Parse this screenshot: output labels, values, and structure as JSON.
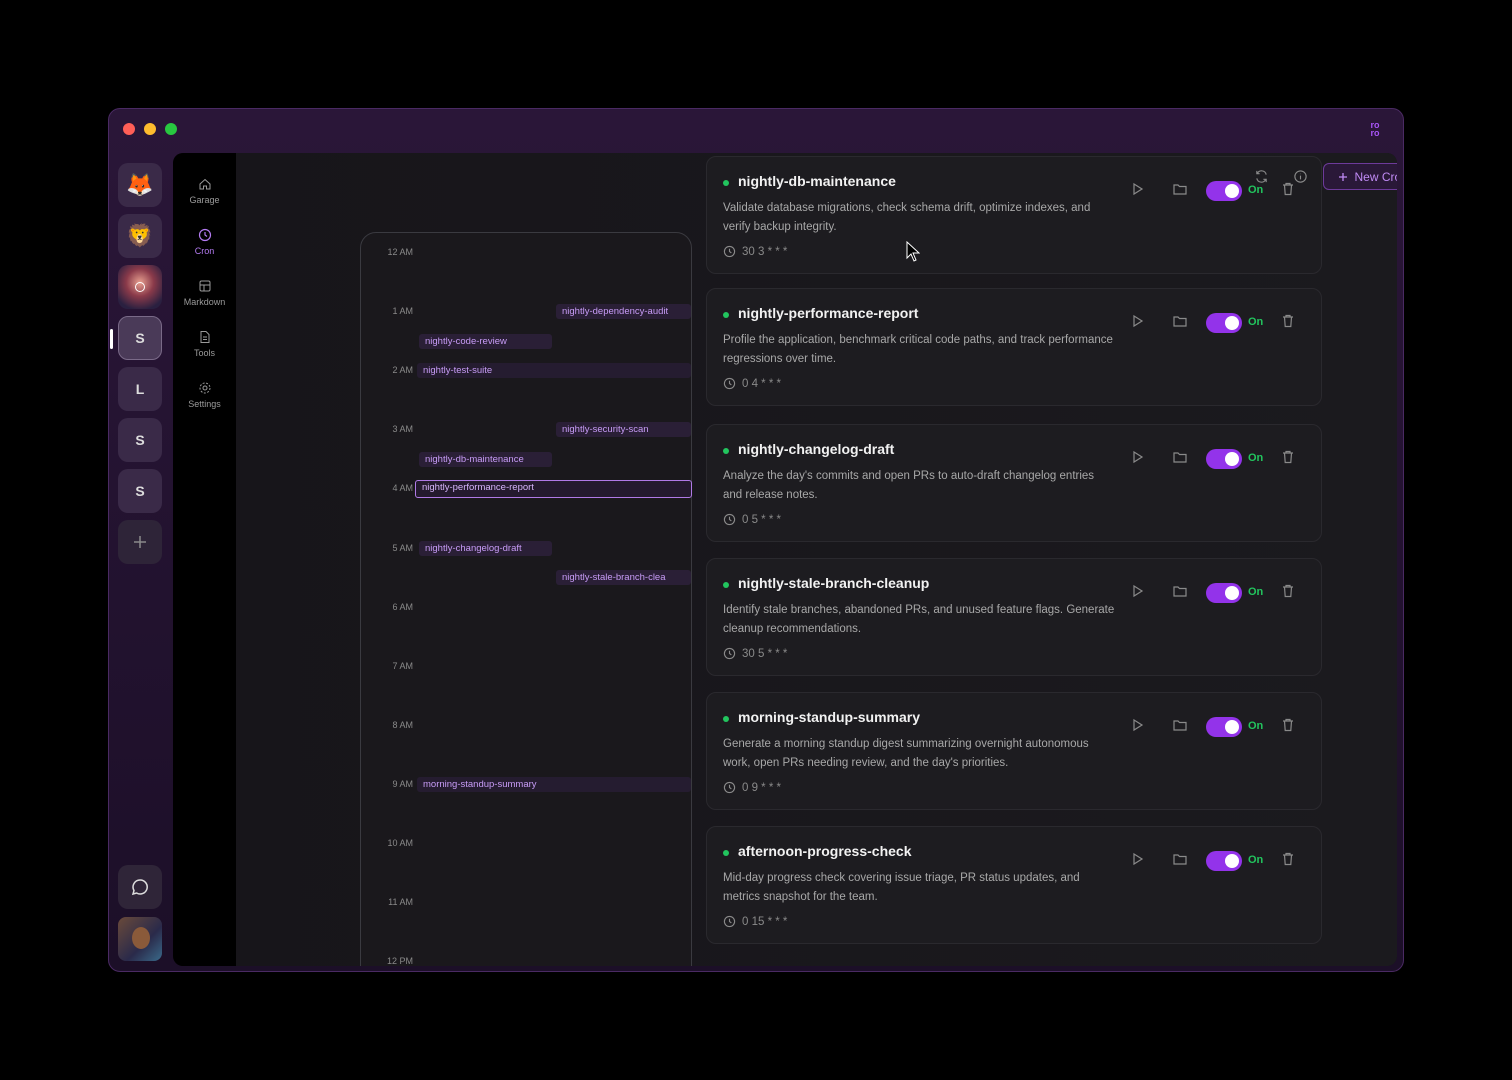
{
  "app": {
    "brand_mark": "ro\nro"
  },
  "workspaces": [
    {
      "label": "",
      "icon": "fox-emoji-icon",
      "emoji": "🦊"
    },
    {
      "label": "",
      "icon": "lion-emoji-icon",
      "emoji": "🦁"
    },
    {
      "label": "",
      "icon": "landscape-avatar-icon",
      "emoji": ""
    },
    {
      "label": "S",
      "active": true
    },
    {
      "label": "L"
    },
    {
      "label": "S"
    },
    {
      "label": "S"
    }
  ],
  "nav": {
    "items": [
      {
        "label": "Garage",
        "icon": "home-icon"
      },
      {
        "label": "Cron",
        "icon": "clock-icon",
        "active": true
      },
      {
        "label": "Markdown",
        "icon": "layout-icon"
      },
      {
        "label": "Tools",
        "icon": "document-icon"
      },
      {
        "label": "Settings",
        "icon": "gear-icon"
      }
    ]
  },
  "toolbar": {
    "new_job_label": "New Cron Job"
  },
  "timeline": {
    "hours": [
      "12 AM",
      "1 AM",
      "2 AM",
      "3 AM",
      "4 AM",
      "5 AM",
      "6 AM",
      "7 AM",
      "8 AM",
      "9 AM",
      "10 AM",
      "11 AM",
      "12 PM"
    ],
    "chips": [
      "nightly-dependency-audit",
      "nightly-code-review",
      "nightly-test-suite",
      "nightly-security-scan",
      "nightly-db-maintenance",
      "nightly-performance-report",
      "nightly-changelog-draft",
      "nightly-stale-branch-clea",
      "morning-standup-summary"
    ]
  },
  "jobs": [
    {
      "name": "nightly-db-maintenance",
      "description": "Validate database migrations, check schema drift, optimize indexes, and verify backup integrity.",
      "schedule": "30 3 * * *",
      "status": "On"
    },
    {
      "name": "nightly-performance-report",
      "description": "Profile the application, benchmark critical code paths, and track performance regressions over time.",
      "schedule": "0 4 * * *",
      "status": "On"
    },
    {
      "name": "nightly-changelog-draft",
      "description": "Analyze the day's commits and open PRs to auto-draft changelog entries and release notes.",
      "schedule": "0 5 * * *",
      "status": "On"
    },
    {
      "name": "nightly-stale-branch-cleanup",
      "description": "Identify stale branches, abandoned PRs, and unused feature flags. Generate cleanup recommendations.",
      "schedule": "30 5 * * *",
      "status": "On"
    },
    {
      "name": "morning-standup-summary",
      "description": "Generate a morning standup digest summarizing overnight autonomous work, open PRs needing review, and the day's priorities.",
      "schedule": "0 9 * * *",
      "status": "On"
    },
    {
      "name": "afternoon-progress-check",
      "description": "Mid-day progress check covering issue triage, PR status updates, and metrics snapshot for the team.",
      "schedule": "0 15 * * *",
      "status": "On"
    }
  ],
  "colors": {
    "accent": "#9333ea",
    "status_on": "#22c55e",
    "chip_text": "#c89cf7"
  }
}
